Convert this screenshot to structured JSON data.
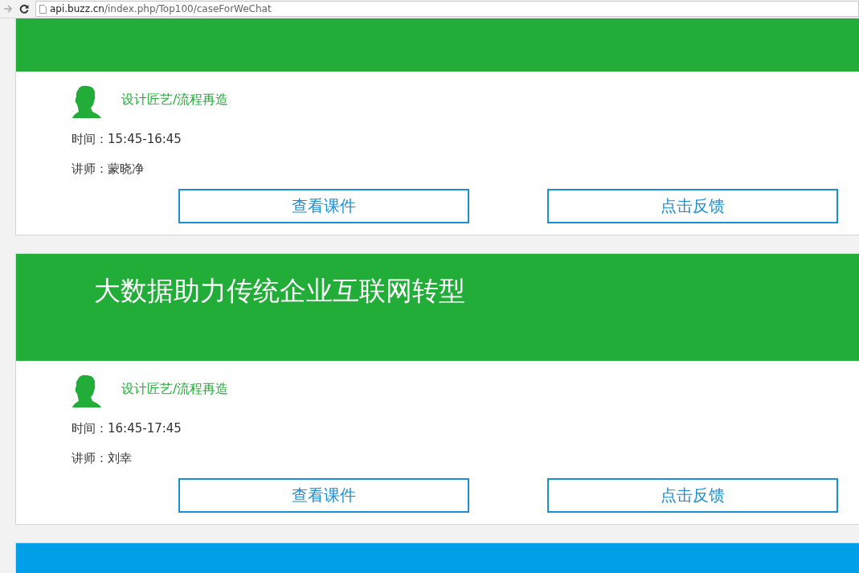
{
  "browser": {
    "url_host": "api.buzz.cn",
    "url_path": "/index.php/Top100/caseForWeChat"
  },
  "sessions": [
    {
      "color": "#22ac38",
      "kind": "cut",
      "category": "设计匠艺/流程再造",
      "time": "时间：15:45-16:45",
      "speaker": "讲师：蒙晓净",
      "buttons": [
        "查看课件",
        "点击反馈"
      ]
    },
    {
      "color": "#22ac38",
      "kind": "full",
      "title": "大数据助力传统企业互联网转型",
      "category": "设计匠艺/流程再造",
      "time": "时间：16:45-17:45",
      "speaker": "讲师：刘幸",
      "buttons": [
        "查看课件",
        "点击反馈"
      ]
    },
    {
      "color": "#009fe8",
      "kind": "full"
    }
  ]
}
